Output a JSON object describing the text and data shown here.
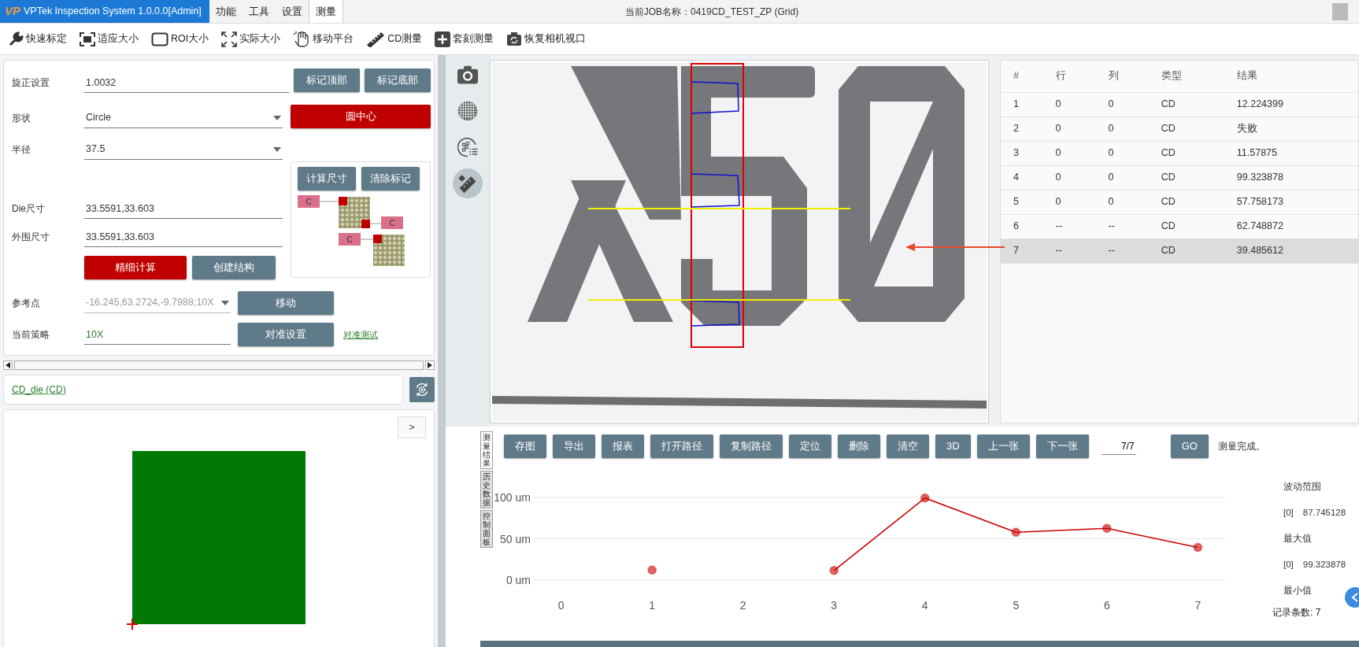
{
  "title_bar": {
    "logo": "VP",
    "app_title": "VPTek Inspection System 1.0.0.0[Admin]",
    "menu": [
      {
        "label": "功能",
        "selected": false
      },
      {
        "label": "工具",
        "selected": false
      },
      {
        "label": "设置",
        "selected": false
      },
      {
        "label": "测量",
        "selected": true
      }
    ],
    "job": "当前JOB名称：0419CD_TEST_ZP (Grid)"
  },
  "toolbar": [
    {
      "label": "快速标定"
    },
    {
      "label": "适应大小"
    },
    {
      "label": "ROI大小"
    },
    {
      "label": "实际大小"
    },
    {
      "label": "移动平台"
    },
    {
      "label": "CD测量"
    },
    {
      "label": "套刻测量"
    },
    {
      "label": "恢复相机视口"
    }
  ],
  "form": {
    "rotation": {
      "label": "旋正设置",
      "value": "1.0032"
    },
    "mark_buttons": [
      "标记顶部",
      "标记底部"
    ],
    "shape": {
      "label": "形状",
      "value": "Circle"
    },
    "circle_center_button": "圆中心",
    "radius": {
      "label": "半径",
      "value": "37.5"
    },
    "calc_buttons": [
      "计算尺寸",
      "清除标记"
    ],
    "diagram_tags": [
      "C",
      "C",
      "C"
    ],
    "die_size": {
      "label": "Die尺寸",
      "value": "33.5591,33.603"
    },
    "outer_size": {
      "label": "外围尺寸",
      "value": "33.5591,33.603"
    },
    "fine_calc_button": "精细计算",
    "create_button": "创建结构",
    "reference": {
      "label": "参考点",
      "value": "-16.245,63.2724,-9.7988;10X",
      "disabled": true
    },
    "move_button": "移动",
    "strategy": {
      "label": "当前策略",
      "value": "10X"
    },
    "align_button": "对准设置",
    "align_test_link": "对准测试"
  },
  "recipe_link": "CD_die (CD)",
  "die_panel": {
    "next_button": ">"
  },
  "image_tools": [
    {
      "selected": false
    },
    {
      "selected": false
    },
    {
      "selected": false
    },
    {
      "selected": true
    }
  ],
  "results_table": {
    "columns": [
      "#",
      "行",
      "列",
      "类型",
      "结果"
    ],
    "rows": [
      {
        "cells": [
          "1",
          "0",
          "0",
          "CD",
          "12.224399"
        ],
        "selected": false
      },
      {
        "cells": [
          "2",
          "0",
          "0",
          "CD",
          "失败"
        ],
        "selected": false
      },
      {
        "cells": [
          "3",
          "0",
          "0",
          "CD",
          "11.57875"
        ],
        "selected": false
      },
      {
        "cells": [
          "4",
          "0",
          "0",
          "CD",
          "99.323878"
        ],
        "selected": false
      },
      {
        "cells": [
          "5",
          "0",
          "0",
          "CD",
          "57.758173"
        ],
        "selected": false
      },
      {
        "cells": [
          "6",
          "--",
          "--",
          "CD",
          "62.748872"
        ],
        "selected": false
      },
      {
        "cells": [
          "7",
          "--",
          "--",
          "CD",
          "39.485612"
        ],
        "selected": true
      }
    ]
  },
  "side_tabs": [
    {
      "label": "测量结果",
      "selected": true
    },
    {
      "label": "历史数据",
      "selected": false
    },
    {
      "label": "控制面板",
      "selected": false
    }
  ],
  "result_toolbar": {
    "buttons": [
      "存图",
      "导出",
      "报表",
      "打开路径",
      "复制路径",
      "定位",
      "删除",
      "清空",
      "3D",
      "上一张",
      "下一张"
    ],
    "page": "7/7",
    "go_button": "GO",
    "status": "测量完成。"
  },
  "chart_data": {
    "type": "line",
    "x": [
      1,
      2,
      3,
      4,
      5,
      6,
      7
    ],
    "series": [
      {
        "color": "#cc0000",
        "marker": true,
        "values": [
          12.2,
          null,
          11.6,
          99.3,
          57.8,
          62.7,
          39.5
        ]
      }
    ],
    "xlim": [
      -0.3,
      7.3
    ],
    "ylim": [
      0,
      100
    ],
    "xticks": [
      0,
      1,
      2,
      3,
      4,
      5,
      6,
      7
    ],
    "yticks": [
      {
        "value": 0,
        "label": "0 um"
      },
      {
        "value": 50,
        "label": "50 um"
      },
      {
        "value": 100,
        "label": "100 um"
      }
    ]
  },
  "stats": [
    {
      "kind": "heading",
      "text": "波动范围"
    },
    {
      "kind": "value",
      "index": "[0]",
      "text": "87.745128"
    },
    {
      "kind": "heading",
      "text": "最大值"
    },
    {
      "kind": "value",
      "index": "[0]",
      "text": "99.323878"
    },
    {
      "kind": "heading",
      "text": "最小值"
    }
  ],
  "record_count": "记录条数: 7"
}
